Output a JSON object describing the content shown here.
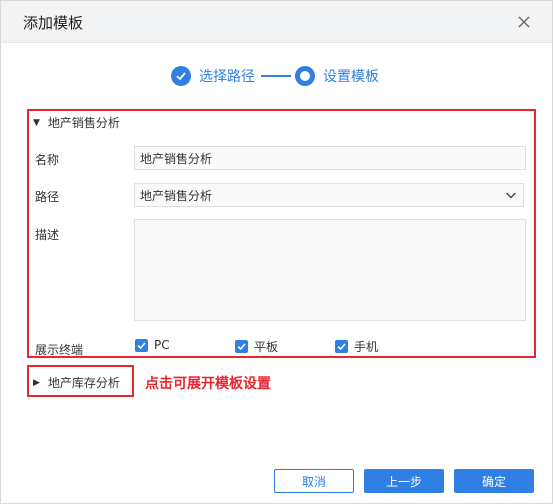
{
  "dialog": {
    "title": "添加模板",
    "steps": [
      {
        "label": "选择路径",
        "state": "done"
      },
      {
        "label": "设置模板",
        "state": "current"
      }
    ]
  },
  "template1": {
    "header": "地产销售分析",
    "expanded": true,
    "fields": {
      "name_label": "名称",
      "name_value": "地产销售分析",
      "path_label": "路径",
      "path_value": "地产销售分析",
      "desc_label": "描述",
      "desc_value": "",
      "terminal_label": "展示终端"
    },
    "terminals": [
      {
        "label": "PC",
        "checked": true
      },
      {
        "label": "平板",
        "checked": true
      },
      {
        "label": "手机",
        "checked": true
      }
    ]
  },
  "template2": {
    "header": "地产库存分析",
    "expanded": false
  },
  "hint": "点击可展开模板设置",
  "buttons": {
    "cancel": "取消",
    "prev": "上一步",
    "confirm": "确定"
  },
  "colors": {
    "accent": "#2f7fe4",
    "highlight": "#e8262f"
  }
}
